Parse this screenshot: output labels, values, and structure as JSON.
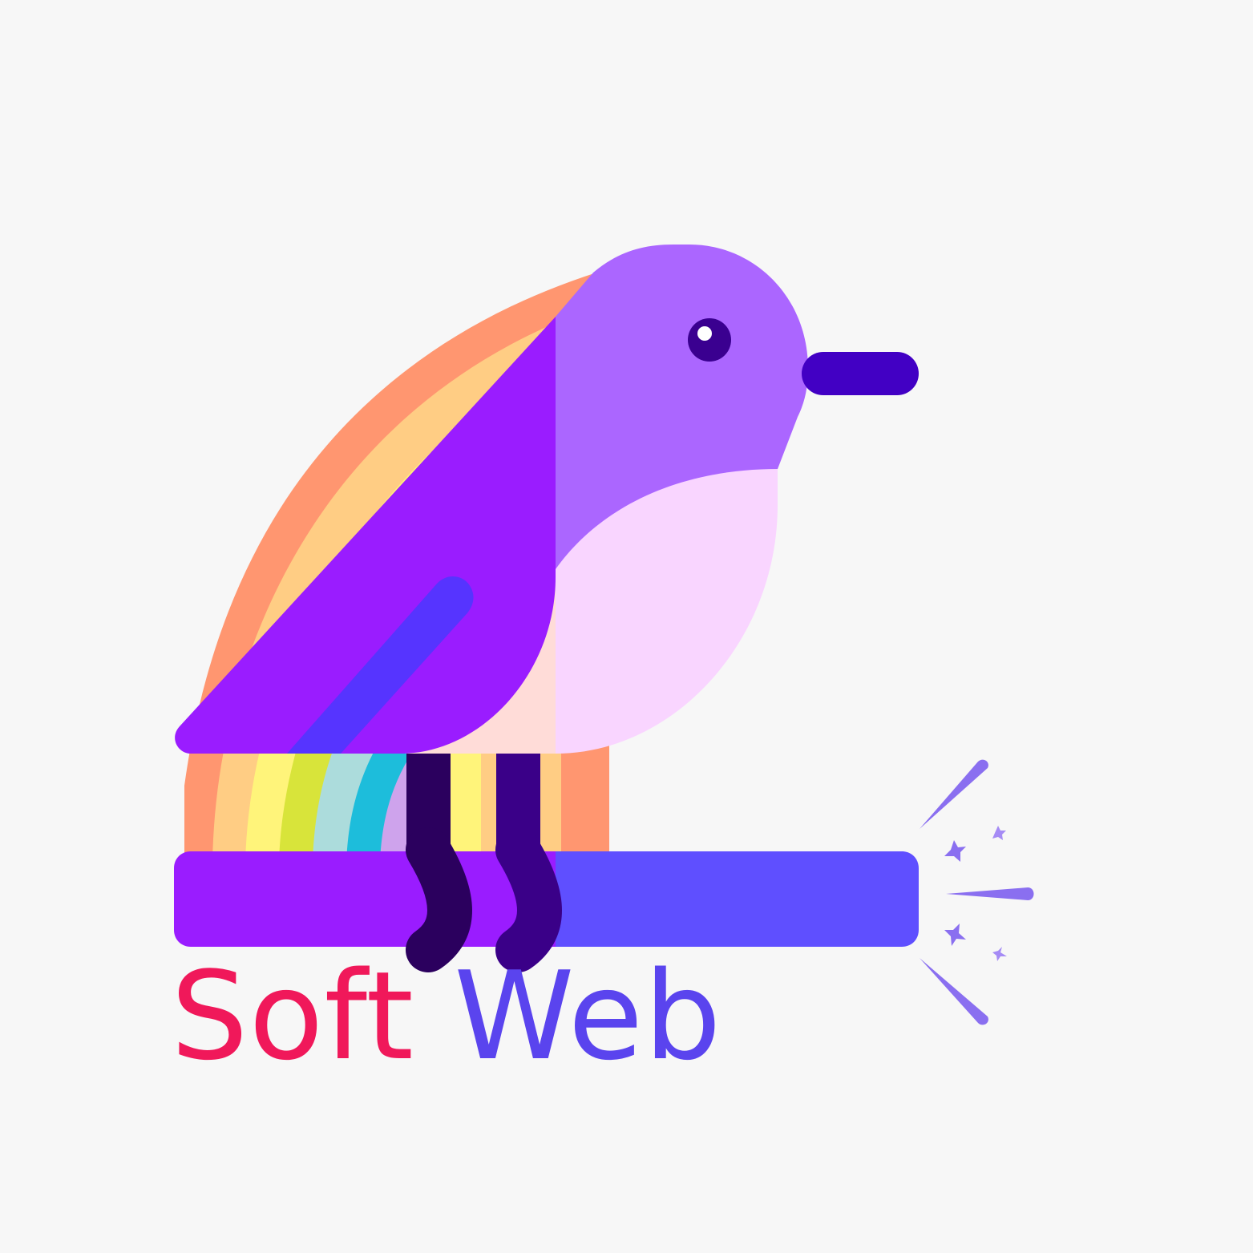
{
  "brand": {
    "name_first": "Soft",
    "name_second": "Web"
  },
  "colors": {
    "background": "#f7f7f7",
    "wordmark_first": "#f0185a",
    "wordmark_second": "#5a44ee",
    "bird_head": "#ab66ff",
    "bird_wing": "#9a1cff",
    "bird_belly": "#f9d5ff",
    "bird_beak": "#4200c4",
    "perch_left": "#9a1cff",
    "perch_right": "#5f4fff",
    "legs": "#2b005e",
    "sparkle": "#8a6ff0"
  },
  "icons": [
    "bird-icon",
    "rainbow-icon",
    "sparkle-icon"
  ]
}
